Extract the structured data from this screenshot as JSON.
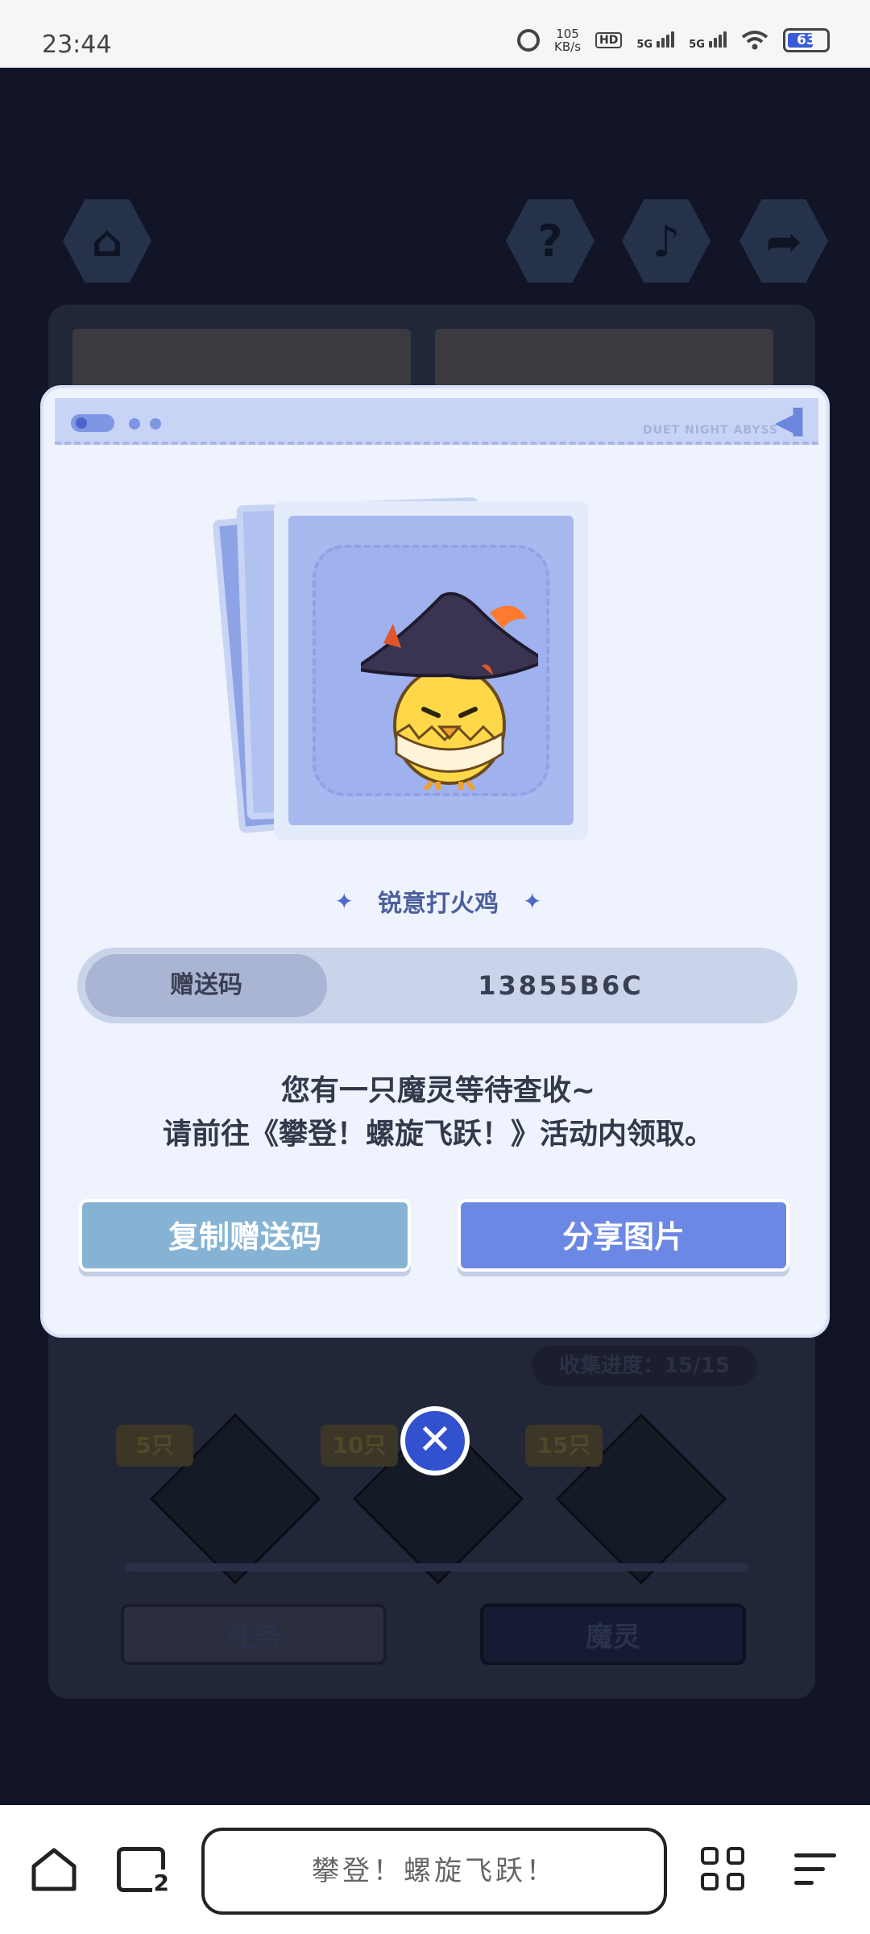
{
  "status_bar": {
    "time": "23:44",
    "speed_value": "105",
    "speed_unit": "KB/s",
    "hd_label": "HD",
    "signal_1": "5G",
    "signal_2": "5G",
    "battery_level": "63"
  },
  "game_background": {
    "progress_label": "收集进度：15/15",
    "milestones": [
      "5只",
      "10只",
      "15只"
    ],
    "task_button": "任务",
    "pet_button": "魔灵"
  },
  "dialog": {
    "brand": "DUET NIGHT ABYSS",
    "pet_name": "锐意打火鸡",
    "code_label": "赠送码",
    "code_value": "13855B6C",
    "message_line1": "您有一只魔灵等待查收~",
    "message_line2": "请前往《攀登！螺旋飞跃！》活动内领取。",
    "copy_button": "复制赠送码",
    "share_button": "分享图片"
  },
  "nav_bar": {
    "page_title": "攀登！螺旋飞跃！",
    "tab_count": "2"
  },
  "colors": {
    "accent": "#6b88e4",
    "copy_button": "#86b3d4",
    "close_button": "#3151cf",
    "dialog_bg": "#eef3fd"
  }
}
